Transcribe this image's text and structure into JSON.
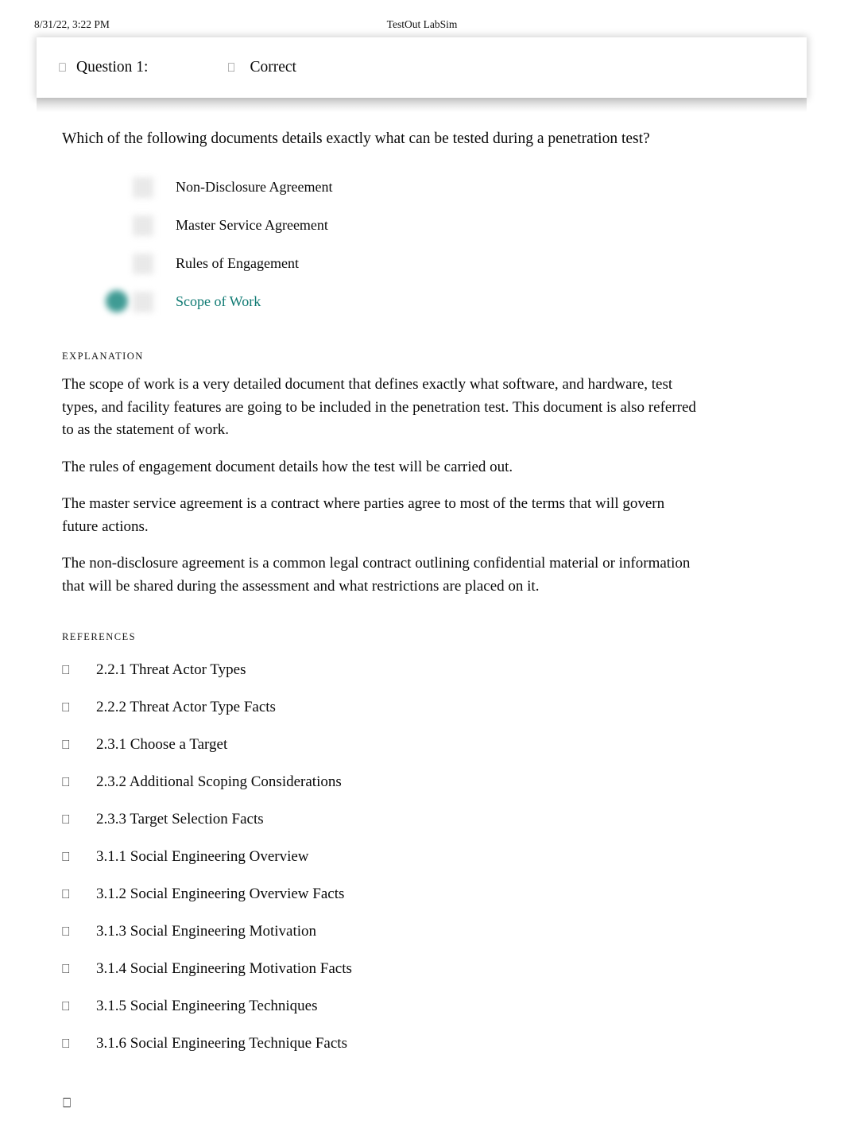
{
  "print_header": {
    "date": "8/31/22, 3:22 PM",
    "title": "TestOut LabSim"
  },
  "question_card": {
    "header": {
      "question_icon": "missing-glyph-box",
      "question_label": "Question 1:",
      "status_icon": "missing-glyph-box",
      "status_label": "Correct"
    },
    "question_text": "Which of the following documents details exactly what can be tested during a penetration test?",
    "options": [
      {
        "label": "Non-Disclosure Agreement",
        "selected": false
      },
      {
        "label": "Master Service Agreement",
        "selected": false
      },
      {
        "label": "Rules of Engagement",
        "selected": false
      },
      {
        "label": "Scope of Work",
        "selected": true
      }
    ],
    "explanation": {
      "heading": "EXPLANATION",
      "paragraphs": [
        "The scope of work is a very detailed document that defines exactly what software, and hardware, test types, and facility features are going to be included in the penetration test. This document is also referred to as the statement of work.",
        "The rules of engagement document details how the test will be carried out.",
        "The master service agreement is a contract where parties agree to most of the terms that will govern future actions.",
        "The non-disclosure agreement is a common legal contract outlining confidential material or information that will be shared during the assessment and what restrictions are placed on it."
      ]
    },
    "references": {
      "heading": "REFERENCES",
      "bullet_icon": "missing-glyph-box",
      "items": [
        "2.2.1 Threat Actor Types",
        "2.2.2 Threat Actor Type Facts",
        "2.3.1 Choose a Target",
        "2.3.2 Additional Scoping Considerations",
        "2.3.3 Target Selection Facts",
        "3.1.1 Social Engineering Overview",
        "3.1.2 Social Engineering Overview Facts",
        "3.1.3 Social Engineering Motivation",
        "3.1.4 Social Engineering Motivation Facts",
        "3.1.5 Social Engineering Techniques",
        "3.1.6 Social Engineering Technique Facts"
      ]
    },
    "trailing_glyph": "missing-glyph-box"
  },
  "glyphs": {
    "tofu": "⎕"
  },
  "colors": {
    "selected_option_text": "#0f7a73",
    "selected_radio_fill": "#3f9b94",
    "body_text": "#0a0a0a",
    "page_background": "#ffffff"
  }
}
